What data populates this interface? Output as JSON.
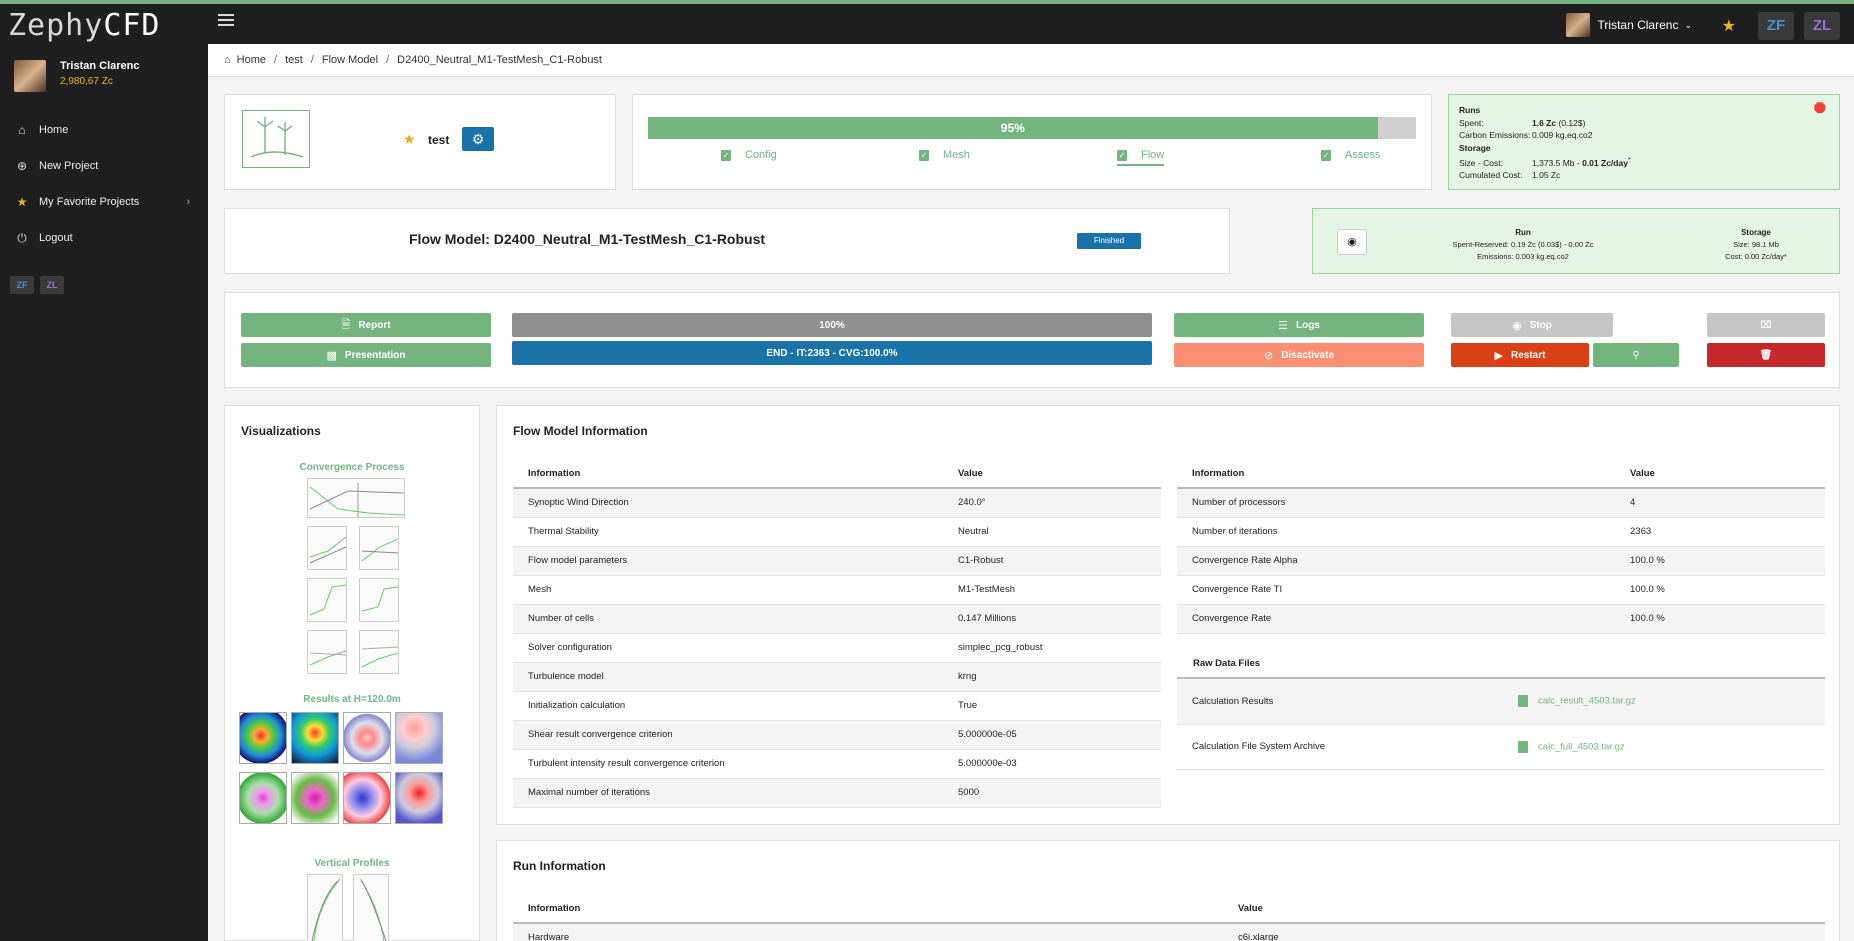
{
  "app": {
    "logo_main": "Zephy",
    "logo_suffix": "CFD",
    "user_name": "Tristan Clarenc",
    "user_credit": "2,980,67 Zc",
    "badge_zf": "ZF",
    "badge_zl": "ZL"
  },
  "sidebar": {
    "items": [
      {
        "label": "Home",
        "icon": "home-icon"
      },
      {
        "label": "New Project",
        "icon": "plus-circle-icon"
      },
      {
        "label": "My Favorite Projects",
        "icon": "star-icon"
      },
      {
        "label": "Logout",
        "icon": "power-icon"
      }
    ]
  },
  "breadcrumb": [
    "Home",
    "test",
    "Flow Model",
    "D2400_Neutral_M1-TestMesh_C1-Robust"
  ],
  "project": {
    "name": "test",
    "progress_label": "95%",
    "progress": 0.95,
    "steps": [
      "Config",
      "Mesh",
      "Flow",
      "Assess"
    ],
    "active_step": "Flow"
  },
  "runs_panel": {
    "runs_title": "Runs",
    "spent_label": "Spent:",
    "spent_value": "1.6 Zc",
    "spent_extra": "(0.12$)",
    "carbon_label": "Carbon Emissions:",
    "carbon_value": "0.009 kg.eq.co2",
    "storage_title": "Storage",
    "size_cost_label": "Size - Cost:",
    "size_cost_value": "1,373.5 Mb - ",
    "size_cost_bold": "0.01 Zc/day",
    "size_cost_sup": "*",
    "cumulated_label": "Cumulated Cost:",
    "cumulated_value": "1.05 Zc"
  },
  "flow_model": {
    "title": "Flow Model: D2400_Neutral_M1-TestMesh_C1-Robust",
    "status": "Finished",
    "run_head": "Run",
    "run_line1": "Spent-Reserved: 0.19 Zc (0.03$) - 0.00 Zc",
    "run_line2": "Emissions: 0.003 kg.eq.co2",
    "storage_head": "Storage",
    "storage_line1": "Size: 98.1 Mb",
    "storage_line2": "Cost: 0.00 Zc/day*"
  },
  "actions": {
    "report": "Report",
    "presentation": "Presentation",
    "progress_label": "100%",
    "status_line": "END - IT:2363 - CVG:100.0%",
    "logs": "Logs",
    "disactivate": "Disactivate",
    "stop": "Stop",
    "restart": "Restart"
  },
  "visualizations": {
    "title": "Visualizations",
    "convergence": "Convergence Process",
    "results": "Results at H=120.0m",
    "profiles": "Vertical Profiles"
  },
  "flow_info": {
    "title": "Flow Model Information",
    "headers": [
      "Information",
      "Value"
    ],
    "rows": [
      [
        "Synoptic Wind Direction",
        "240.0°"
      ],
      [
        "Thermal Stability",
        "Neutral"
      ],
      [
        "Flow model parameters",
        "C1-Robust"
      ],
      [
        "Mesh",
        "M1-TestMesh"
      ],
      [
        "Number of cells",
        "0.147 Millions"
      ],
      [
        "Solver configuration",
        "simplec_pcg_robust"
      ],
      [
        "Turbulence model",
        "krng"
      ],
      [
        "Initialization calculation",
        "True"
      ],
      [
        "Shear result convergence criterion",
        "5.000000e-05"
      ],
      [
        "Turbulent intensity result convergence criterion",
        "5.000000e-03"
      ],
      [
        "Maximal number of iterations",
        "5000"
      ]
    ],
    "right_headers": [
      "Information",
      "Value"
    ],
    "right_rows": [
      [
        "Number of processors",
        "4"
      ],
      [
        "Number of iterations",
        "2363"
      ],
      [
        "Convergence Rate Alpha",
        "100.0 %"
      ],
      [
        "Convergence Rate TI",
        "100.0 %"
      ],
      [
        "Convergence Rate",
        "100.0 %"
      ]
    ],
    "raw_title": "Raw Data Files",
    "raw_rows": [
      [
        "Calculation Results",
        "calc_result_4503.tar.gz"
      ],
      [
        "Calculation File System Archive",
        "calc_full_4503.tar.gz"
      ]
    ]
  },
  "run_info": {
    "title": "Run Information",
    "headers": [
      "Information",
      "Value"
    ],
    "rows": [
      [
        "Hardware",
        "c6i.xlarge"
      ]
    ]
  }
}
